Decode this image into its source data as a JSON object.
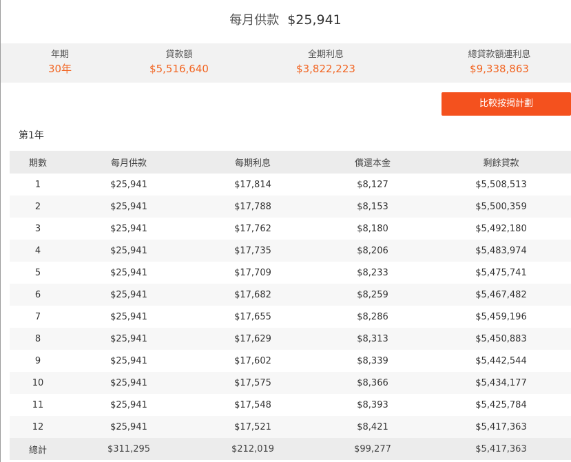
{
  "header": {
    "monthly_label": "每月供款",
    "monthly_value": "$25,941"
  },
  "summary": [
    {
      "label": "年期",
      "value": "30年"
    },
    {
      "label": "貸款額",
      "value": "$5,516,640"
    },
    {
      "label": "全期利息",
      "value": "$3,822,223"
    },
    {
      "label": "總貸款額連利息",
      "value": "$9,338,863"
    }
  ],
  "compare_button": "比較按揭計劃",
  "year_title": "第1年",
  "table": {
    "columns": [
      "期數",
      "每月供款",
      "每期利息",
      "償還本金",
      "剩餘貸款"
    ],
    "rows": [
      [
        "1",
        "$25,941",
        "$17,814",
        "$8,127",
        "$5,508,513"
      ],
      [
        "2",
        "$25,941",
        "$17,788",
        "$8,153",
        "$5,500,359"
      ],
      [
        "3",
        "$25,941",
        "$17,762",
        "$8,180",
        "$5,492,180"
      ],
      [
        "4",
        "$25,941",
        "$17,735",
        "$8,206",
        "$5,483,974"
      ],
      [
        "5",
        "$25,941",
        "$17,709",
        "$8,233",
        "$5,475,741"
      ],
      [
        "6",
        "$25,941",
        "$17,682",
        "$8,259",
        "$5,467,482"
      ],
      [
        "7",
        "$25,941",
        "$17,655",
        "$8,286",
        "$5,459,196"
      ],
      [
        "8",
        "$25,941",
        "$17,629",
        "$8,313",
        "$5,450,883"
      ],
      [
        "9",
        "$25,941",
        "$17,602",
        "$8,339",
        "$5,442,544"
      ],
      [
        "10",
        "$25,941",
        "$17,575",
        "$8,366",
        "$5,434,177"
      ],
      [
        "11",
        "$25,941",
        "$17,548",
        "$8,393",
        "$5,425,784"
      ],
      [
        "12",
        "$25,941",
        "$17,521",
        "$8,421",
        "$5,417,363"
      ]
    ],
    "total": [
      "總計",
      "$311,295",
      "$212,019",
      "$99,277",
      "$5,417,363"
    ]
  },
  "colors": {
    "accent": "#f26522",
    "button": "#f4511e"
  }
}
